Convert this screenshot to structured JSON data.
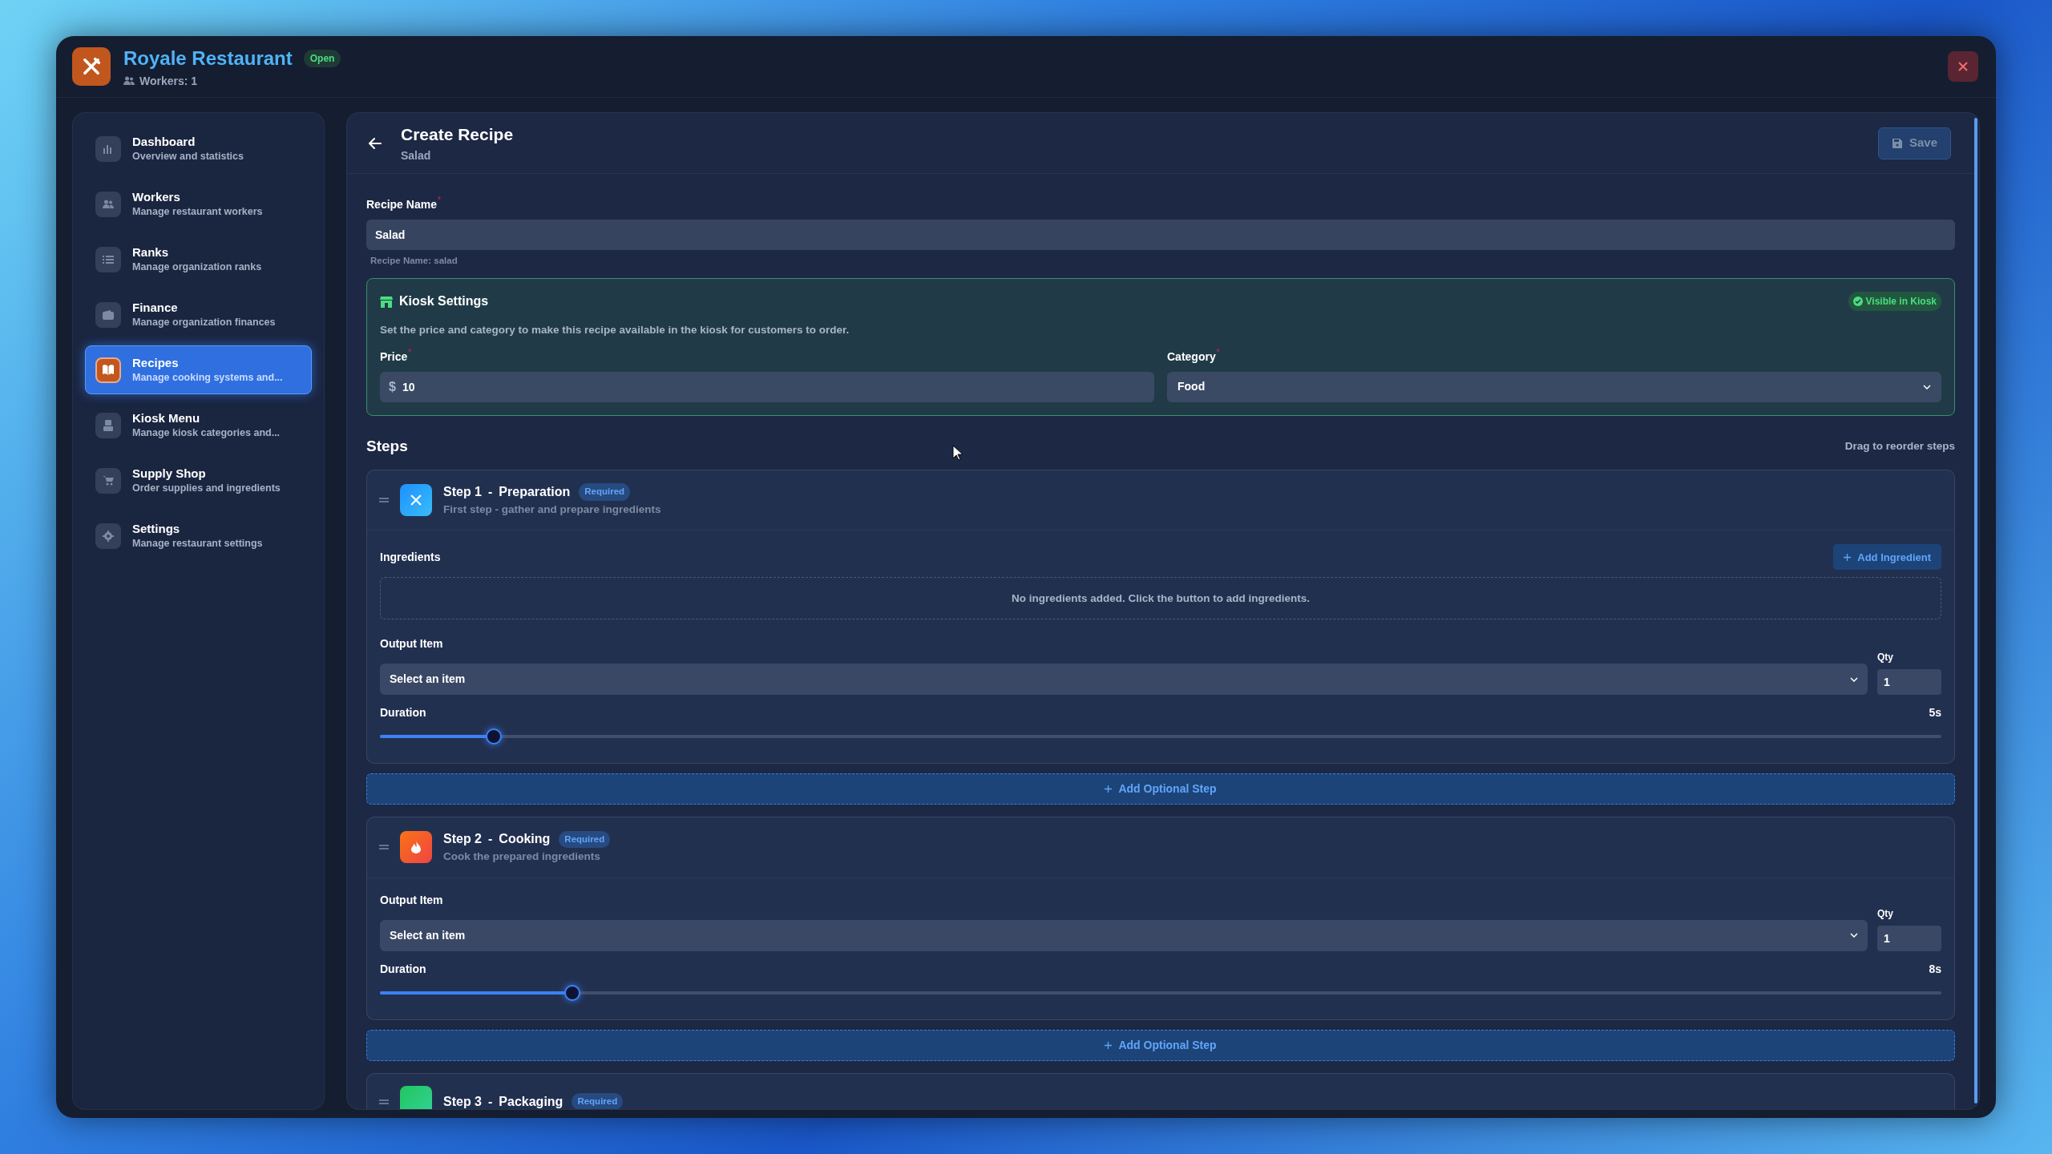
{
  "app": {
    "title": "Royale Restaurant",
    "status": "Open",
    "workers": "Workers: 1"
  },
  "sidebar": {
    "items": [
      {
        "title": "Dashboard",
        "subtitle": "Overview and statistics",
        "selected": false
      },
      {
        "title": "Workers",
        "subtitle": "Manage restaurant workers",
        "selected": false
      },
      {
        "title": "Ranks",
        "subtitle": "Manage organization ranks",
        "selected": false
      },
      {
        "title": "Finance",
        "subtitle": "Manage organization finances",
        "selected": false
      },
      {
        "title": "Recipes",
        "subtitle": "Manage cooking systems and...",
        "selected": true
      },
      {
        "title": "Kiosk Menu",
        "subtitle": "Manage kiosk categories and...",
        "selected": false
      },
      {
        "title": "Supply Shop",
        "subtitle": "Order supplies and ingredients",
        "selected": false
      },
      {
        "title": "Settings",
        "subtitle": "Manage restaurant settings",
        "selected": false
      }
    ]
  },
  "page": {
    "title": "Create Recipe",
    "subtitle": "Salad",
    "save_button": {
      "label": "Save",
      "disabled": true
    }
  },
  "recipe_name": {
    "label": "Recipe Name",
    "required_mark": "*",
    "value": "Salad",
    "hint": "Recipe Name: salad"
  },
  "kiosk": {
    "title": "Kiosk Settings",
    "badge": "Visible in Kiosk",
    "description": "Set the price and category to make this recipe available in the kiosk for customers to order.",
    "price": {
      "label": "Price",
      "required_mark": "*",
      "currency": "$",
      "value": "10"
    },
    "category": {
      "label": "Category",
      "required_mark": "*",
      "value": "Food"
    }
  },
  "steps_header": {
    "title": "Steps",
    "hint": "Drag to reorder steps"
  },
  "steps": [
    {
      "kind": "preparation",
      "number": "Step 1",
      "separator": "-",
      "name": "Preparation",
      "badge": "Required",
      "description": "First step - gather and prepare ingredients",
      "ingredients": {
        "label": "Ingredients",
        "button": "Add Ingredient",
        "empty": "No ingredients added. Click the button to add ingredients."
      },
      "output": {
        "label": "Output Item",
        "placeholder": "Select an item",
        "qty_label": "Qty",
        "qty": "1"
      },
      "duration": {
        "label": "Duration",
        "reading": "5s",
        "level": 0.073
      },
      "add_step": "Add Optional Step"
    },
    {
      "kind": "cooking",
      "number": "Step 2",
      "separator": "-",
      "name": "Cooking",
      "badge": "Required",
      "description": "Cook the prepared ingredients",
      "output": {
        "label": "Output Item",
        "placeholder": "Select an item",
        "qty_label": "Qty",
        "qty": "1"
      },
      "duration": {
        "label": "Duration",
        "reading": "8s",
        "level": 0.123
      },
      "add_step": "Add Optional Step"
    },
    {
      "kind": "packaging",
      "number": "Step 3",
      "separator": "-",
      "name": "Packaging",
      "badge": "Required"
    }
  ]
}
